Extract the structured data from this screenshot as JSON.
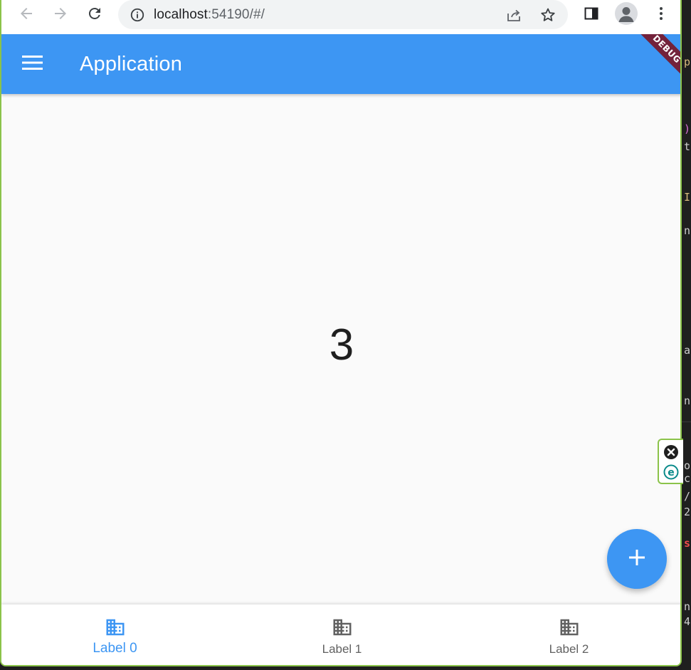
{
  "browser": {
    "url_host": "localhost",
    "url_rest": ":54190/#/",
    "accent_color": "#8bc34a"
  },
  "app": {
    "title": "Application",
    "counter_value": "3",
    "debug_banner": "DEBUG",
    "primary_color": "#3d96f3",
    "inactive_color": "#616161",
    "nav_items": [
      {
        "label": "Label 0",
        "icon": "business-icon",
        "selected": true
      },
      {
        "label": "Label 1",
        "icon": "business-icon",
        "selected": false
      },
      {
        "label": "Label 2",
        "icon": "business-icon",
        "selected": false
      }
    ]
  },
  "extension_widget": {
    "icons": [
      "close-circle-icon",
      "e-extension-icon"
    ]
  },
  "editor_strip": {
    "glyphs": [
      "p",
      ")",
      "t",
      "I",
      "n",
      "a",
      "n",
      "o",
      "c",
      "/",
      "2",
      "s",
      "n",
      "4"
    ]
  }
}
